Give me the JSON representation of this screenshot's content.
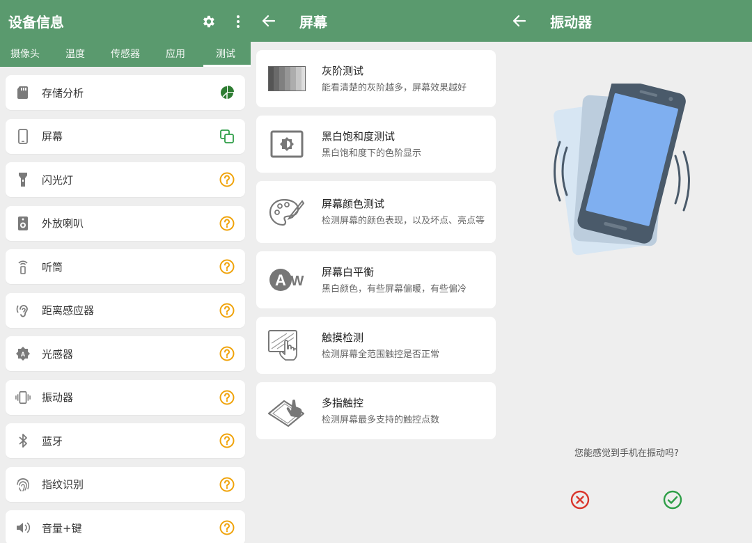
{
  "colors": {
    "accent": "#5a9a6e",
    "help": "#f0a30a",
    "green": "#2e9e47",
    "red": "#d9352b"
  },
  "screen1": {
    "title": "设备信息",
    "tabs": [
      "摄像头",
      "温度",
      "传感器",
      "应用",
      "测试"
    ],
    "active_tab": "测试",
    "items": [
      {
        "label": "存储分析",
        "icon": "sd-card-icon",
        "status": "pie-chart-icon"
      },
      {
        "label": "屏幕",
        "icon": "phone-icon",
        "status": "copy-icon"
      },
      {
        "label": "闪光灯",
        "icon": "flashlight-icon",
        "status": "help-icon"
      },
      {
        "label": "外放喇叭",
        "icon": "speaker-icon",
        "status": "help-icon"
      },
      {
        "label": "听筒",
        "icon": "earpiece-icon",
        "status": "help-icon"
      },
      {
        "label": "距离感应器",
        "icon": "ear-icon",
        "status": "help-icon"
      },
      {
        "label": "光感器",
        "icon": "brightness-icon",
        "status": "help-icon"
      },
      {
        "label": "振动器",
        "icon": "vibrate-icon",
        "status": "help-icon"
      },
      {
        "label": "蓝牙",
        "icon": "bluetooth-icon",
        "status": "help-icon"
      },
      {
        "label": "指纹识别",
        "icon": "fingerprint-icon",
        "status": "help-icon"
      },
      {
        "label": "音量+键",
        "icon": "volume-icon",
        "status": "help-icon"
      }
    ]
  },
  "screen2": {
    "title": "屏幕",
    "tests": [
      {
        "title": "灰阶测试",
        "desc": "能看清楚的灰阶越多，屏幕效果越好",
        "icon": "grayscale-icon"
      },
      {
        "title": "黑白饱和度测试",
        "desc": "黑白饱和度下的色阶显示",
        "icon": "contrast-icon"
      },
      {
        "title": "屏幕颜色测试",
        "desc": "检测屏幕的颜色表现，以及坏点、亮点等",
        "icon": "palette-icon"
      },
      {
        "title": "屏幕白平衡",
        "desc": "黑白颜色，有些屏幕偏暖，有些偏冷",
        "icon": "white-balance-icon"
      },
      {
        "title": "触摸检测",
        "desc": "检测屏幕全范围触控是否正常",
        "icon": "touch-icon"
      },
      {
        "title": "多指触控",
        "desc": "检测屏幕最多支持的触控点数",
        "icon": "multitouch-icon"
      }
    ]
  },
  "screen3": {
    "title": "振动器",
    "question": "您能感觉到手机在振动吗?",
    "no_icon": "cancel-icon",
    "yes_icon": "check-icon"
  }
}
